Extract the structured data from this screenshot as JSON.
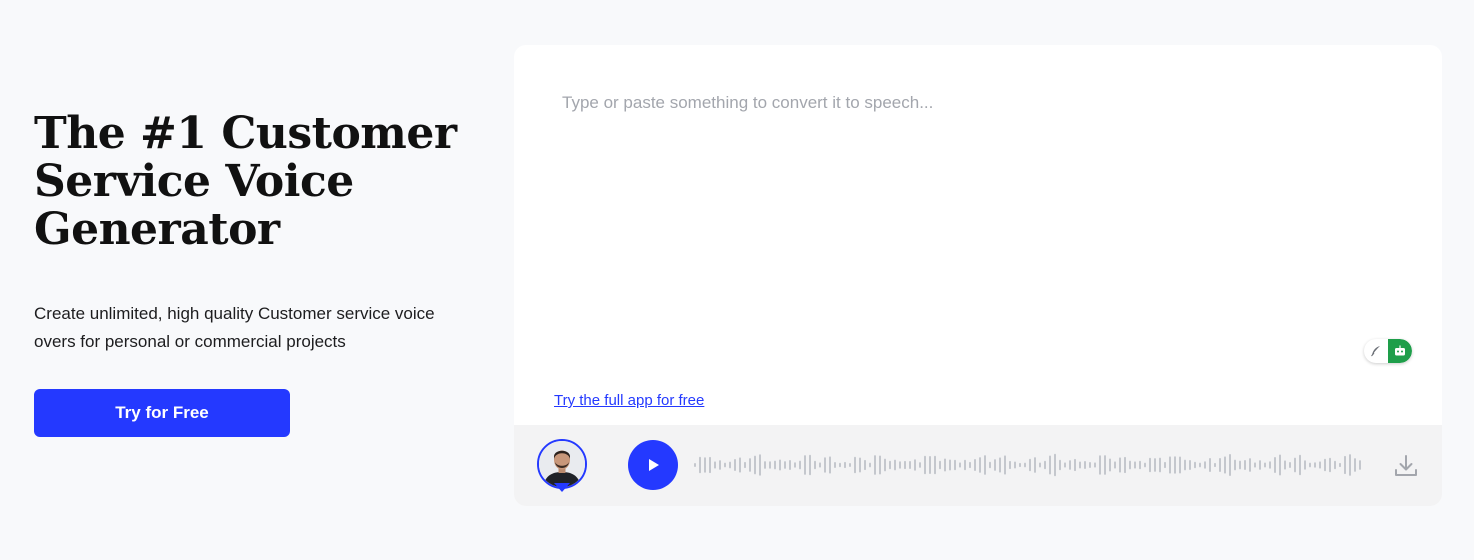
{
  "hero": {
    "title": "The #1 Customer Service Voice Generator",
    "subtitle": "Create unlimited, high quality Customer service voice overs for personal or commercial projects",
    "cta_label": "Try for Free"
  },
  "editor": {
    "placeholder": "Type or paste something to convert it to speech...",
    "full_app_link": "Try the full app for free"
  },
  "icons": {
    "toggle_left": "feather-icon",
    "toggle_right": "robot-icon",
    "play": "play-icon",
    "download": "download-icon"
  },
  "colors": {
    "accent": "#2439ff",
    "toggle_active": "#1e9e4a",
    "page_bg": "#f8f9fb",
    "player_bg": "#f3f3f4",
    "waveform": "#c4c7cd"
  }
}
